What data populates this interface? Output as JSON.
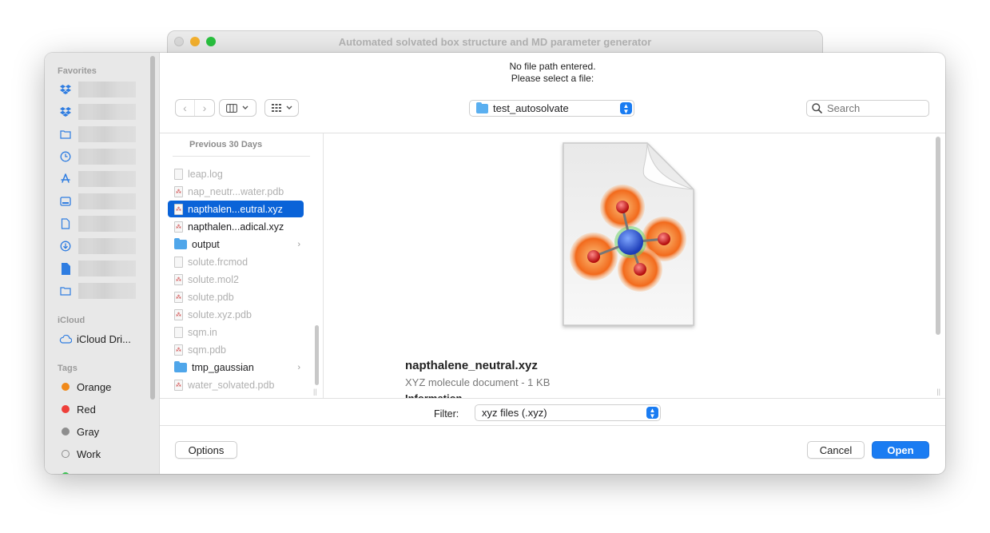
{
  "app": {
    "window_title": "Automated solvated box structure and MD parameter generator"
  },
  "sidebar": {
    "favorites_heading": "Favorites",
    "favorites_icons": [
      "dropbox-icon",
      "dropbox-icon",
      "folder-icon",
      "clock-icon",
      "applications-icon",
      "desktop-icon",
      "document-icon",
      "download-icon",
      "file-icon",
      "folder-icon"
    ],
    "icloud_heading": "iCloud",
    "icloud_drive_label": "iCloud Dri...",
    "tags_heading": "Tags",
    "tags": [
      {
        "label": "Orange",
        "color": "#f0891a"
      },
      {
        "label": "Red",
        "color": "#ee3f3a"
      },
      {
        "label": "Gray",
        "color": "#8e8e8e"
      },
      {
        "label": "Work",
        "color": "hollow"
      }
    ]
  },
  "header": {
    "message_line1": "No file path entered.",
    "message_line2": "Please select a file:",
    "back_icon": "‹",
    "forward_icon": "›",
    "location": "test_autosolvate",
    "search_placeholder": "Search"
  },
  "file_column": {
    "section_heading": "Previous 30 Days",
    "items": [
      {
        "name": "leap.log",
        "kind": "doc",
        "enabled": false,
        "selected": false
      },
      {
        "name": "nap_neutr...water.pdb",
        "kind": "molecule",
        "enabled": false,
        "selected": false
      },
      {
        "name": "napthalen...eutral.xyz",
        "kind": "molecule",
        "enabled": true,
        "selected": true
      },
      {
        "name": "napthalen...adical.xyz",
        "kind": "molecule",
        "enabled": true,
        "selected": false
      },
      {
        "name": "output",
        "kind": "folder",
        "enabled": true,
        "selected": false
      },
      {
        "name": "solute.frcmod",
        "kind": "doc",
        "enabled": false,
        "selected": false
      },
      {
        "name": "solute.mol2",
        "kind": "molecule",
        "enabled": false,
        "selected": false
      },
      {
        "name": "solute.pdb",
        "kind": "molecule",
        "enabled": false,
        "selected": false
      },
      {
        "name": "solute.xyz.pdb",
        "kind": "molecule",
        "enabled": false,
        "selected": false
      },
      {
        "name": "sqm.in",
        "kind": "doc",
        "enabled": false,
        "selected": false
      },
      {
        "name": "sqm.pdb",
        "kind": "molecule",
        "enabled": false,
        "selected": false
      },
      {
        "name": "tmp_gaussian",
        "kind": "folder",
        "enabled": true,
        "selected": false
      },
      {
        "name": "water_solvated.pdb",
        "kind": "molecule",
        "enabled": false,
        "selected": false
      }
    ]
  },
  "preview": {
    "file_name": "napthalene_neutral.xyz",
    "file_kind": "XYZ molecule document - 1 KB",
    "info_heading": "Information"
  },
  "filter": {
    "label": "Filter:",
    "selected": "xyz files (.xyz)"
  },
  "buttons": {
    "options": "Options",
    "cancel": "Cancel",
    "open": "Open"
  }
}
